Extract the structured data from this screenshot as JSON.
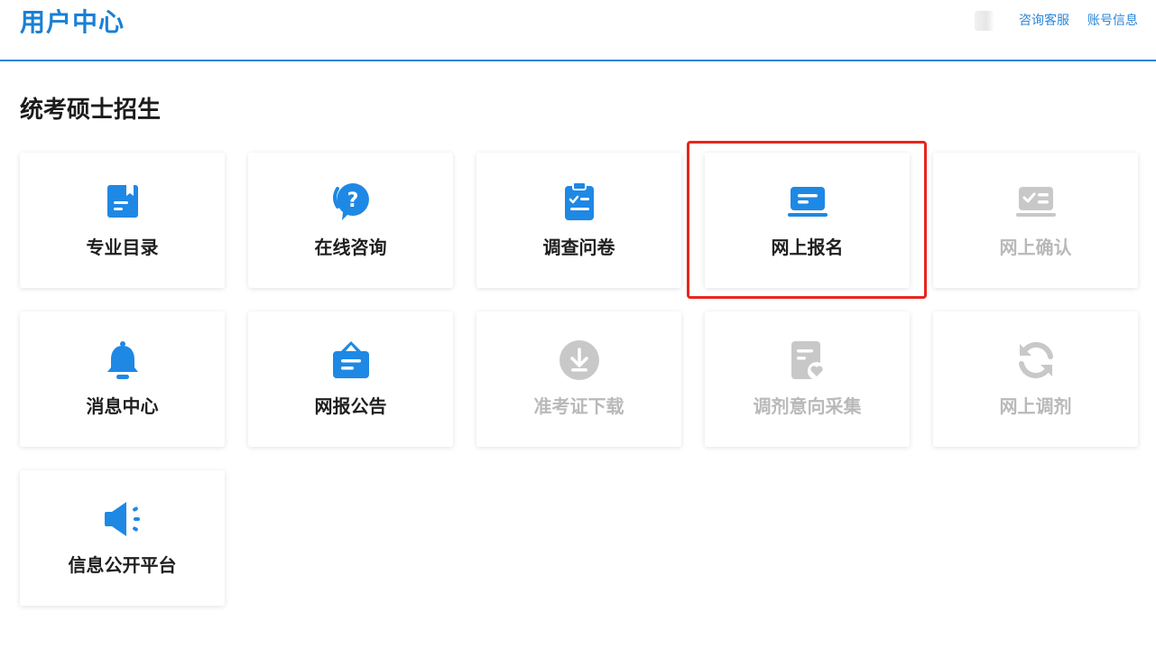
{
  "header": {
    "title": "用户中心",
    "links": [
      "咨询客服",
      "账号信息"
    ]
  },
  "section": {
    "title": "统考硕士招生"
  },
  "colors": {
    "accent": "#1a7fd6",
    "active_icon": "#1e88e5",
    "disabled": "#c8c8c8",
    "highlight": "#e8261d"
  },
  "cards": [
    {
      "label": "专业目录",
      "icon": "bookmark-doc-icon",
      "enabled": true
    },
    {
      "label": "在线咨询",
      "icon": "question-chat-icon",
      "enabled": true
    },
    {
      "label": "调查问卷",
      "icon": "clipboard-check-icon",
      "enabled": true
    },
    {
      "label": "网上报名",
      "icon": "laptop-icon",
      "enabled": true
    },
    {
      "label": "网上确认",
      "icon": "laptop-check-icon",
      "enabled": false
    },
    {
      "label": "消息中心",
      "icon": "bell-icon",
      "enabled": true
    },
    {
      "label": "网报公告",
      "icon": "notice-board-icon",
      "enabled": true
    },
    {
      "label": "准考证下载",
      "icon": "download-icon",
      "enabled": false
    },
    {
      "label": "调剂意向采集",
      "icon": "doc-heart-icon",
      "enabled": false
    },
    {
      "label": "网上调剂",
      "icon": "refresh-icon",
      "enabled": false
    },
    {
      "label": "信息公开平台",
      "icon": "speaker-icon",
      "enabled": true
    }
  ]
}
